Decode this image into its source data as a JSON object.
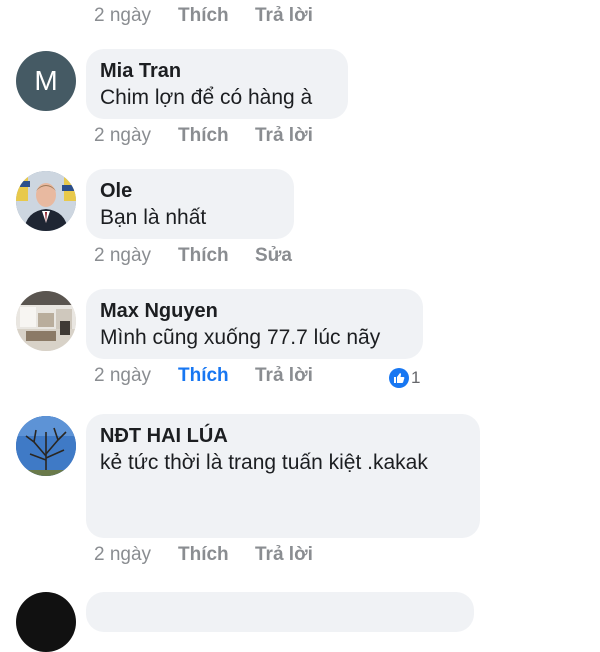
{
  "top_actions": {
    "time": "2 ngày",
    "like": "Thích",
    "reply": "Trả lời"
  },
  "comments": [
    {
      "avatar_letter": "M",
      "avatar_color": "#455a64",
      "name": "Mia Tran",
      "text": "Chim lợn để có hàng à",
      "time": "2 ngày",
      "like": "Thích",
      "action": "Trả lời"
    },
    {
      "avatar_icon": "person-photo-icon",
      "name": "Ole",
      "text": "Bạn là nhất",
      "time": "2 ngày",
      "like": "Thích",
      "action": "Sửa"
    },
    {
      "avatar_icon": "room-photo-icon",
      "name": "Max Nguyen",
      "text": "Mình cũng xuống 77.7 lúc nãy",
      "time": "2 ngày",
      "like": "Thích",
      "like_active": true,
      "action": "Trả lời",
      "reaction_icon": "thumbs-up-icon",
      "reaction_count": "1"
    },
    {
      "avatar_icon": "tree-photo-icon",
      "name": "NĐT HAI LÚA",
      "text": "kẻ tức thời là trang tuấn kiệt .kakak",
      "time": "2 ngày",
      "like": "Thích",
      "action": "Trả lời"
    }
  ],
  "colors": {
    "bubble": "#f0f2f5",
    "muted": "#8a8d91",
    "accent": "#1877f2"
  }
}
